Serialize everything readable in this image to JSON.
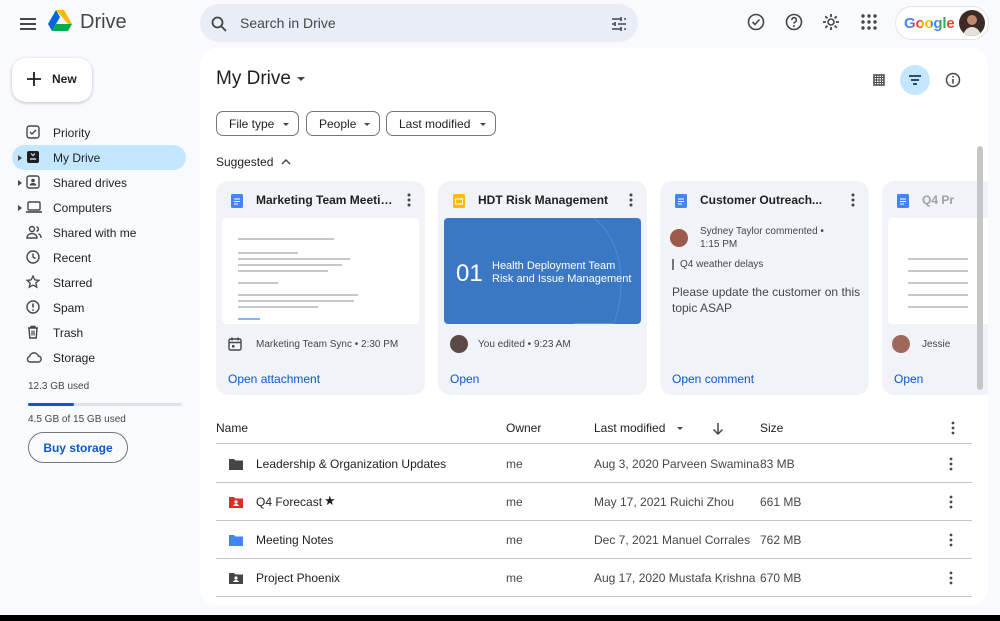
{
  "app": {
    "name": "Drive"
  },
  "search": {
    "placeholder": "Search in Drive"
  },
  "account": {
    "brand": "Google"
  },
  "sidebar": {
    "new_label": "New",
    "items": [
      {
        "label": "Priority",
        "icon": "priority-icon"
      },
      {
        "label": "My Drive",
        "icon": "my-drive-icon",
        "active": true
      },
      {
        "label": "Shared drives",
        "icon": "shared-drives-icon"
      },
      {
        "label": "Computers",
        "icon": "computer-icon"
      },
      {
        "label": "Shared with me",
        "icon": "people-icon"
      },
      {
        "label": "Recent",
        "icon": "clock-icon"
      },
      {
        "label": "Starred",
        "icon": "star-icon"
      },
      {
        "label": "Spam",
        "icon": "spam-icon"
      },
      {
        "label": "Trash",
        "icon": "trash-icon"
      },
      {
        "label": "Storage",
        "icon": "cloud-icon"
      }
    ],
    "storage_used": "12.3 GB used",
    "storage_fraction": 0.3,
    "storage_total": "4.5 GB of 15 GB used",
    "buy_storage": "Buy storage"
  },
  "main": {
    "title": "My Drive",
    "filters": [
      "File type",
      "People",
      "Last modified"
    ],
    "suggested_label": "Suggested",
    "cards": [
      {
        "title": "Marketing Team Meetin...",
        "type": "docs",
        "meta": "Marketing Team Sync • 2:30 PM",
        "meta_icon": "calendar-icon",
        "action": "Open attachment"
      },
      {
        "title": "HDT Risk Management",
        "type": "slides",
        "slide_number": "01",
        "slide_title": "Health Deployment Team Risk and Issue Management",
        "meta": "You edited • 9:23 AM",
        "action": "Open"
      },
      {
        "title": "Customer Outreach...",
        "type": "docs",
        "comment_author": "Sydney Taylor commented • 1:15 PM",
        "comment_quote": "Q4 weather delays",
        "comment_body": "Please update the customer on this topic ASAP",
        "action": "Open comment"
      },
      {
        "title": "Q4 Pr",
        "type": "docs",
        "meta": "Jessie",
        "action": "Open"
      }
    ],
    "table": {
      "headers": {
        "name": "Name",
        "owner": "Owner",
        "modified": "Last modified",
        "size": "Size"
      },
      "rows": [
        {
          "name": "Leadership & Organization Updates",
          "owner": "me",
          "modified": "Aug 3, 2020 Parveen Swamina",
          "size": "83 MB",
          "icon": "folder-icon",
          "color": "#444746",
          "starred": false
        },
        {
          "name": "Q4 Forecast",
          "owner": "me",
          "modified": "May 17, 2021 Ruichi Zhou",
          "size": "661 MB",
          "icon": "shared-folder-icon",
          "color": "#d93025",
          "starred": true
        },
        {
          "name": "Meeting Notes",
          "owner": "me",
          "modified": "Dec 7, 2021 Manuel Corrales",
          "size": "762 MB",
          "icon": "folder-icon",
          "color": "#4285f4",
          "starred": false
        },
        {
          "name": "Project Phoenix",
          "owner": "me",
          "modified": "Aug 17, 2020 Mustafa Krishna",
          "size": "670 MB",
          "icon": "shared-folder-icon",
          "color": "#444746",
          "starred": false
        }
      ]
    }
  }
}
